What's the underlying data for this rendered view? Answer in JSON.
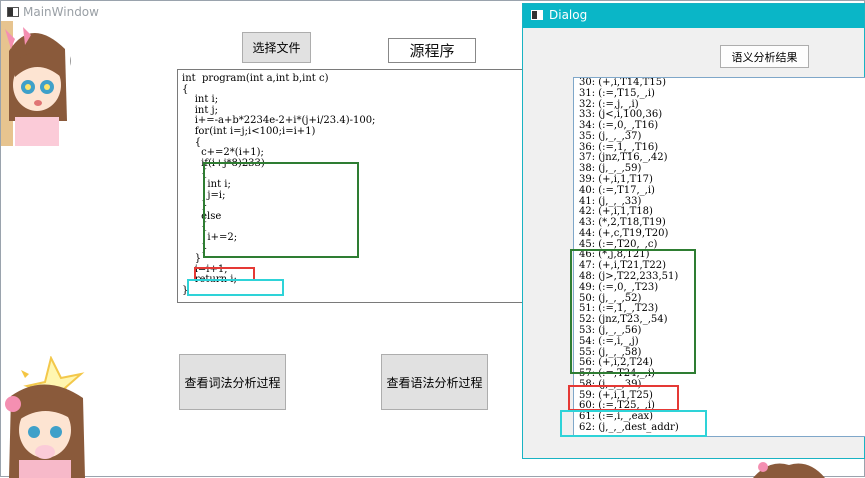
{
  "main_window": {
    "title": "MainWindow",
    "select_file_button": "选择文件",
    "source_label": "源程序",
    "lexical_button": "查看词法分析过程",
    "syntax_button": "查看语法分析过程",
    "code_lines": [
      "int  program(int a,int b,int c)",
      "{",
      "    int i;",
      "    int j;",
      "    i+=-a+b*2234e-2+i*(j+i/23.4)-100;",
      "    for(int i=j;i<100;i=i+1)",
      "    {",
      "      c+=2*(i+1);",
      "      if(i+j*8)233)",
      "      {",
      "        int i;",
      "        j=i;",
      "      }",
      "      else",
      "      {",
      "        i+=2;",
      "      }",
      "    }",
      "    i=i+1;",
      "    return i;",
      "}"
    ]
  },
  "dialog": {
    "title": "Dialog",
    "result_button": "语义分析结果",
    "ir_lines": [
      "30: (+,i,T14,T15)",
      "31: (:=,T15,_,i)",
      "32: (:=,j,_,i)",
      "33: (j<,i,100,36)",
      "34: (:=,0,_,T16)",
      "35: (j,_,_,37)",
      "36: (:=,1,_,T16)",
      "37: (jnz,T16,_,42)",
      "38: (j,_,_,59)",
      "39: (+,i,1,T17)",
      "40: (:=,T17,_,i)",
      "41: (j,_,_,33)",
      "42: (+,i,1,T18)",
      "43: (*,2,T18,T19)",
      "44: (+,c,T19,T20)",
      "45: (:=,T20,_,c)",
      "46: (*,j,8,T21)",
      "47: (+,i,T21,T22)",
      "48: (j>,T22,233,51)",
      "49: (:=,0,_,T23)",
      "50: (j,_,_,52)",
      "51: (:=,1,_,T23)",
      "52: (jnz,T23,_,54)",
      "53: (j,_,_,56)",
      "54: (:=,i,_,j)",
      "55: (j,_,_,58)",
      "56: (+,i,2,T24)",
      "57: (:=,T24,_,i)",
      "58: (j,_,_,39)",
      "59: (+,i,1,T25)",
      "60: (:=,T25,_,i)",
      "61: (:=,i,_,eax)",
      "62: (j,_,_,dest_addr)"
    ]
  },
  "colors": {
    "dialog_titlebar": "#0ab6c7",
    "highlight_green": "#2e7d32",
    "highlight_red": "#e53935",
    "highlight_cyan": "#2ed3d8"
  }
}
